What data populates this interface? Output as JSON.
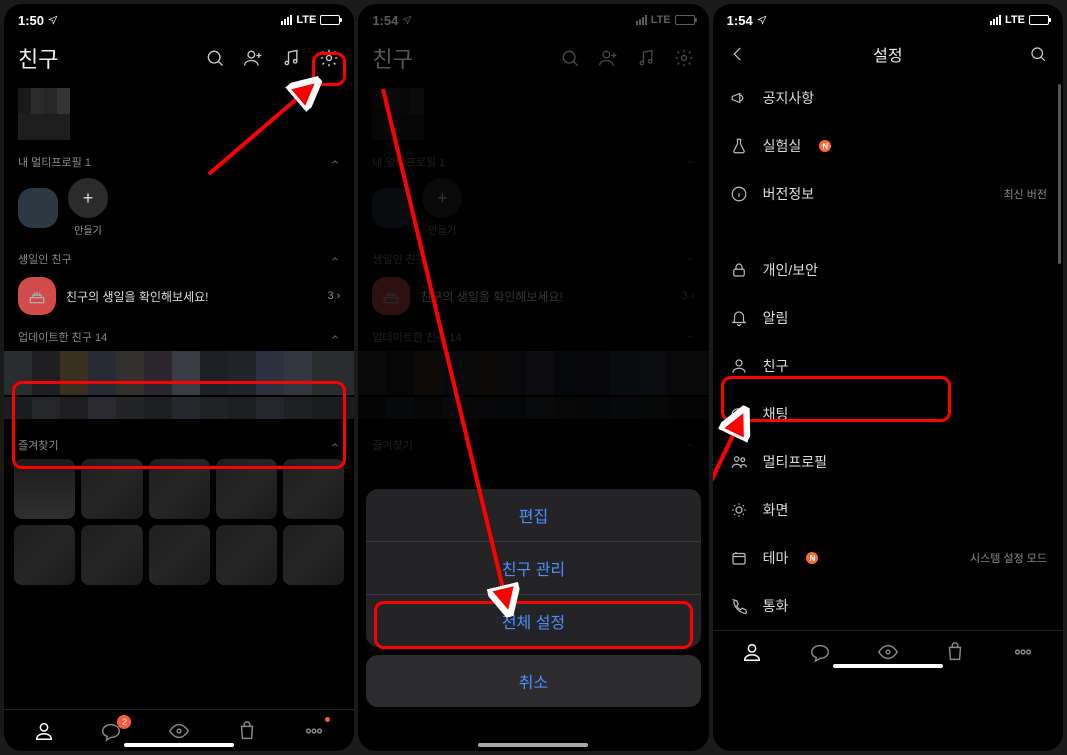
{
  "statusbar": {
    "time1": "1:50",
    "time2": "1:54",
    "time3": "1:54",
    "network": "LTE"
  },
  "common": {
    "friends_title": "친구",
    "multi_profile": "내 멀티프로필 1",
    "make": "만들기",
    "bday_header": "생일인 친구",
    "bday_text": "친구의 생일을 확인해보세요!",
    "bday_count": "3",
    "updated_header": "업데이트한 친구 14",
    "favorites": "즐겨찾기"
  },
  "tabs": {
    "chat_badge": "2"
  },
  "sheet": {
    "edit": "편집",
    "manage": "친구 관리",
    "all_settings": "전체 설정",
    "cancel": "취소"
  },
  "settings": {
    "title": "설정",
    "notice": "공지사항",
    "lab": "실험실",
    "version": "버전정보",
    "version_right": "최신 버전",
    "privacy": "개인/보안",
    "notif": "알림",
    "friends": "친구",
    "chat": "채팅",
    "multiprofile": "멀티프로필",
    "display": "화면",
    "theme": "테마",
    "theme_right": "시스템 설정 모드",
    "call": "통화",
    "n_badge": "N"
  }
}
